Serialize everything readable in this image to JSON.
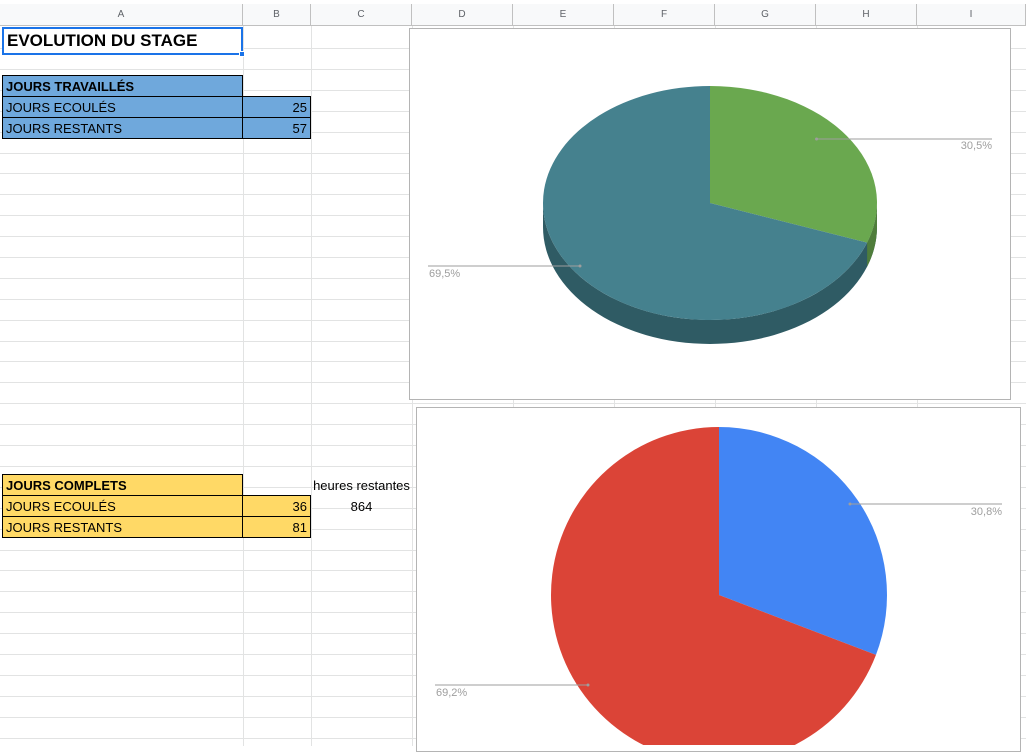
{
  "columns": [
    "A",
    "B",
    "C",
    "D",
    "E",
    "F",
    "G",
    "H",
    "I"
  ],
  "title": "EVOLUTION DU STAGE",
  "table_travailles": {
    "header": "JOURS TRAVAILLÉS",
    "rows": [
      {
        "label": "JOURS ECOULÉS",
        "value": "25"
      },
      {
        "label": "JOURS RESTANTS",
        "value": "57"
      }
    ]
  },
  "table_complets": {
    "header": "JOURS COMPLETS",
    "rows": [
      {
        "label": "JOURS ECOULÉS",
        "value": "36"
      },
      {
        "label": "JOURS RESTANTS",
        "value": "81"
      }
    ],
    "extra_header": "heures restantes",
    "extra_value": "864"
  },
  "chart_data": [
    {
      "type": "pie",
      "style": "3d",
      "slices": [
        {
          "value": 30.5,
          "label": "30,5%",
          "color": "#6aa84f",
          "side_color": "#4f7d3b"
        },
        {
          "value": 69.5,
          "label": "69,5%",
          "color": "#45818e",
          "side_color": "#2f5b64"
        }
      ]
    },
    {
      "type": "pie",
      "style": "2d",
      "slices": [
        {
          "value": 30.8,
          "label": "30,8%",
          "color": "#4285f4"
        },
        {
          "value": 69.2,
          "label": "69,2%",
          "color": "#db4437"
        }
      ]
    }
  ]
}
